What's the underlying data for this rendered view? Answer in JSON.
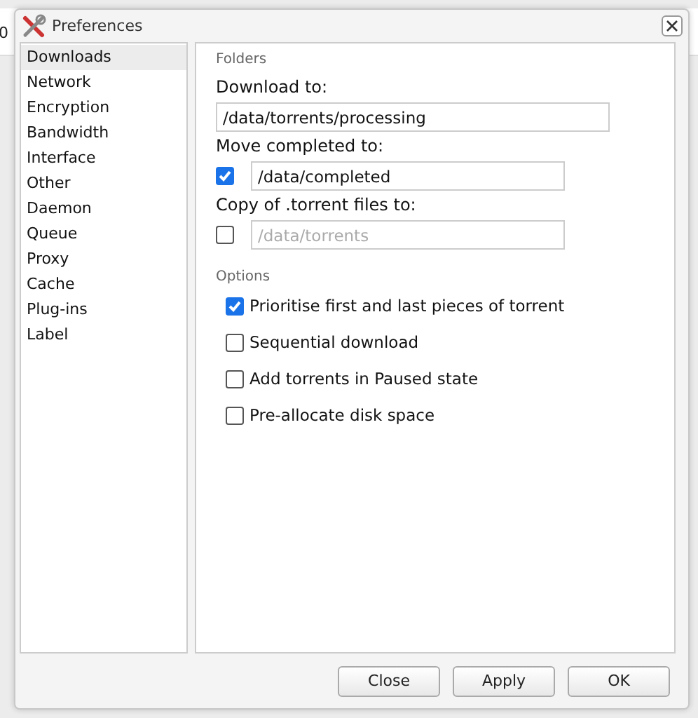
{
  "background": {
    "text": "0"
  },
  "window": {
    "title": "Preferences"
  },
  "sidebar": {
    "items": [
      {
        "label": "Downloads",
        "selected": true
      },
      {
        "label": "Network",
        "selected": false
      },
      {
        "label": "Encryption",
        "selected": false
      },
      {
        "label": "Bandwidth",
        "selected": false
      },
      {
        "label": "Interface",
        "selected": false
      },
      {
        "label": "Other",
        "selected": false
      },
      {
        "label": "Daemon",
        "selected": false
      },
      {
        "label": "Queue",
        "selected": false
      },
      {
        "label": "Proxy",
        "selected": false
      },
      {
        "label": "Cache",
        "selected": false
      },
      {
        "label": "Plug-ins",
        "selected": false
      },
      {
        "label": "Label",
        "selected": false
      }
    ]
  },
  "folders": {
    "title": "Folders",
    "rows": [
      {
        "kind": "plain",
        "label": "Download to:",
        "value": "/data/torrents/processing",
        "disabled": false
      },
      {
        "kind": "checked",
        "label": "Move completed to:",
        "checked": true,
        "value": "/data/completed",
        "disabled": false
      },
      {
        "kind": "checked",
        "label": "Copy of .torrent files to:",
        "checked": false,
        "value": "/data/torrents",
        "disabled": true
      }
    ]
  },
  "options": {
    "title": "Options",
    "items": [
      {
        "label": "Prioritise first and last pieces of torrent",
        "checked": true
      },
      {
        "label": "Sequential download",
        "checked": false
      },
      {
        "label": "Add torrents in Paused state",
        "checked": false
      },
      {
        "label": "Pre-allocate disk space",
        "checked": false
      }
    ]
  },
  "buttons": [
    "Close",
    "Apply",
    "OK"
  ]
}
